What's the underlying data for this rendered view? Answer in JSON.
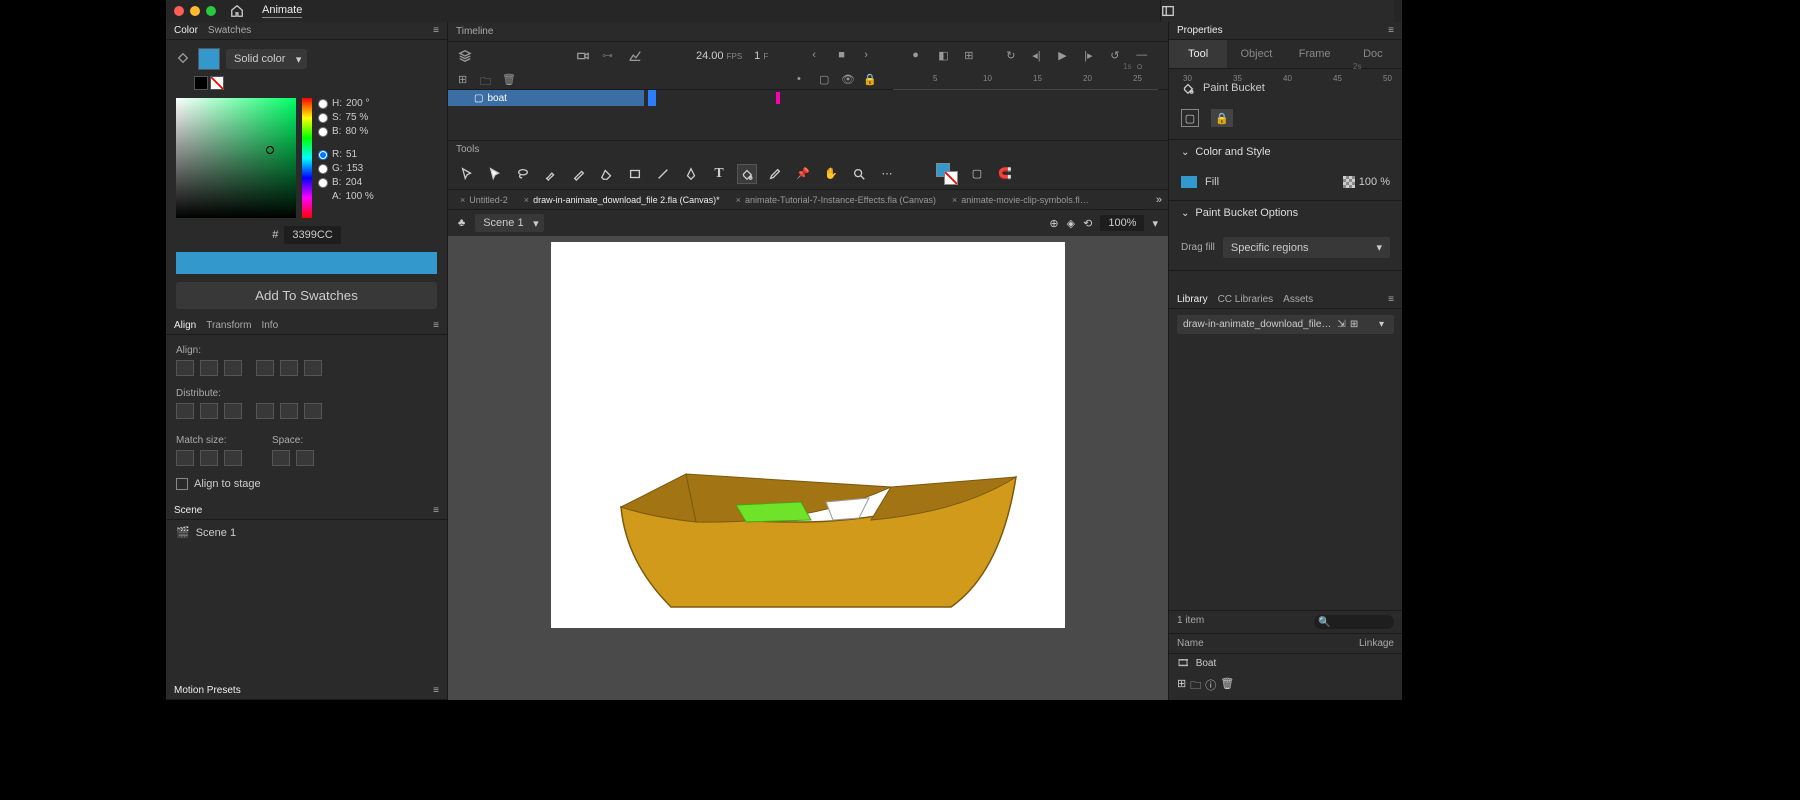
{
  "app": {
    "name": "Animate"
  },
  "panels": {
    "color": {
      "tab1": "Color",
      "tab2": "Swatches",
      "fill_type": "Solid color",
      "H": "200 °",
      "S": "75 %",
      "B": "80 %",
      "R": "51",
      "G": "153",
      "Bv": "204",
      "A": "100 %",
      "hex": "3399CC",
      "add_btn": "Add To Swatches"
    },
    "align": {
      "tab1": "Align",
      "tab2": "Transform",
      "tab3": "Info",
      "l_align": "Align:",
      "l_dist": "Distribute:",
      "l_match": "Match size:",
      "l_space": "Space:",
      "align_stage": "Align to stage"
    },
    "scene": {
      "title": "Scene",
      "item1": "Scene 1"
    },
    "motion": {
      "title": "Motion Presets"
    }
  },
  "timeline": {
    "title": "Timeline",
    "fps": "24.00",
    "fps_lbl": "FPS",
    "frame": "1",
    "frame_lbl": "F",
    "layer1": "boat",
    "ticks": [
      "5",
      "10",
      "15",
      "20",
      "25",
      "30",
      "35",
      "40",
      "45",
      "50"
    ],
    "sec_marks": [
      "1s",
      "2s"
    ]
  },
  "tools": {
    "title": "Tools"
  },
  "docs": {
    "tabs": [
      "Untitled-2",
      "draw-in-animate_download_file 2.fla (Canvas)*",
      "animate-Tutorial-7-Instance-Effects.fla (Canvas)",
      "animate-movie-clip-symbols.fl…"
    ],
    "active": 1
  },
  "scene_bar": {
    "scene": "Scene 1",
    "zoom": "100%"
  },
  "properties": {
    "title": "Properties",
    "tabs": [
      "Tool",
      "Object",
      "Frame",
      "Doc"
    ],
    "active": 0,
    "tool_name": "Paint Bucket",
    "sec_color": "Color and Style",
    "fill_label": "Fill",
    "opacity": "100 %",
    "sec_pb": "Paint Bucket Options",
    "drag_fill": "Drag fill",
    "drag_value": "Specific regions"
  },
  "library": {
    "tab1": "Library",
    "tab2": "CC Libraries",
    "tab3": "Assets",
    "doc": "draw-in-animate_download_file…",
    "count": "1 item",
    "col_name": "Name",
    "col_link": "Linkage",
    "item1": "Boat"
  },
  "colors": {
    "accent": "#3399cc",
    "boat_body": "#d29a1a",
    "boat_dark": "#a27414",
    "seat_green": "#6ee329"
  }
}
